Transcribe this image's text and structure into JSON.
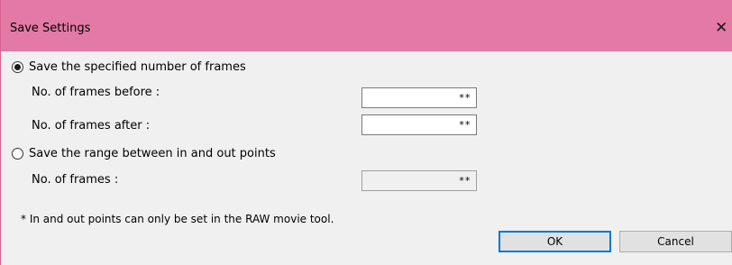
{
  "window": {
    "title": "Save Settings",
    "close_glyph": "✕",
    "titlebar_color": "#e37aa5"
  },
  "options": {
    "specified": {
      "label": "Save the specified number of frames",
      "selected": true,
      "frames_before": {
        "label": "No. of frames before :",
        "value": "**"
      },
      "frames_after": {
        "label": "No. of frames after :",
        "value": "**"
      }
    },
    "range": {
      "label": "Save the range between in and out points",
      "selected": false,
      "frames": {
        "label": "No. of frames :",
        "value": "**",
        "disabled": true
      }
    }
  },
  "note": "* In and out points can only be set in the RAW movie tool.",
  "buttons": {
    "ok": "OK",
    "cancel": "Cancel"
  }
}
